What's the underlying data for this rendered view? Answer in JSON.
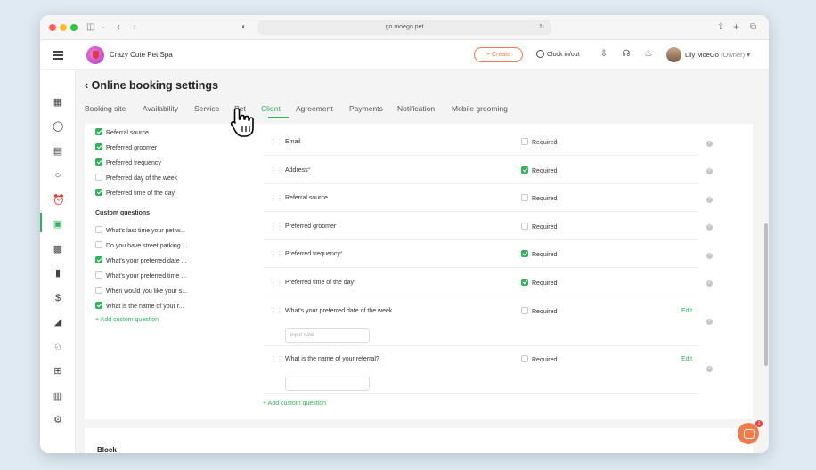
{
  "browser": {
    "url": "go.moego.pet",
    "icons": [
      "sidebar-toggle-icon",
      "back-icon",
      "forward-icon",
      "shield-icon",
      "translate-icon",
      "reload-icon",
      "share-icon",
      "new-tab-icon",
      "tabs-icon"
    ]
  },
  "header": {
    "business_name": "Crazy Cute Pet Spa",
    "create_label": "+ Create",
    "clock_label": "Clock in/out",
    "user_name": "Lily MoeGo",
    "user_role": "(Owner)"
  },
  "colors": {
    "accent": "#2fb35b",
    "brand": "#f27b4a",
    "required": "#e04545"
  },
  "page": {
    "title": "Online booking settings",
    "tabs": [
      {
        "label": "Booking site"
      },
      {
        "label": "Availability"
      },
      {
        "label": "Service"
      },
      {
        "label": "Pet"
      },
      {
        "label": "Client",
        "active": true
      },
      {
        "label": "Agreement"
      },
      {
        "label": "Payments"
      },
      {
        "label": "Notification"
      },
      {
        "label": "Mobile grooming"
      }
    ]
  },
  "left_list": {
    "items": [
      {
        "label": "Referral source",
        "checked": true
      },
      {
        "label": "Preferred groomer",
        "checked": true
      },
      {
        "label": "Preferred frequency",
        "checked": true
      },
      {
        "label": "Preferred day of the week",
        "checked": false
      },
      {
        "label": "Preferred time of the day",
        "checked": true
      }
    ],
    "custom_title": "Custom questions",
    "custom_items": [
      {
        "label": "What's last time your pet w...",
        "checked": false
      },
      {
        "label": "Do you have street parking ...",
        "checked": false
      },
      {
        "label": "What's your preferred date ...",
        "checked": true
      },
      {
        "label": "What's your preferred time ...",
        "checked": false
      },
      {
        "label": "When would you like your s...",
        "checked": false
      },
      {
        "label": "What is the name of your r...",
        "checked": true
      }
    ],
    "add_label": "+ Add custom question"
  },
  "right_list": {
    "required_label": "Required",
    "edit_label": "Edit",
    "rows": [
      {
        "label": "Email",
        "required_star": false,
        "required": false
      },
      {
        "label": "Address",
        "required_star": true,
        "required": true
      },
      {
        "label": "Referral source",
        "required_star": false,
        "required": false
      },
      {
        "label": "Preferred groomer",
        "required_star": false,
        "required": false
      },
      {
        "label": "Preferred frequency",
        "required_star": true,
        "required": true
      },
      {
        "label": "Preferred time of the day",
        "required_star": true,
        "required": true
      },
      {
        "label": "What's your preferred date of the week",
        "required_star": false,
        "required": false,
        "editable": true,
        "placeholder": "input date"
      },
      {
        "label": "What is the name of your referral?",
        "required_star": false,
        "required": false,
        "editable": true,
        "placeholder": ""
      }
    ],
    "add_label": "+ Add custom question"
  },
  "block": {
    "title": "Block"
  },
  "chat": {
    "badge": "1"
  }
}
